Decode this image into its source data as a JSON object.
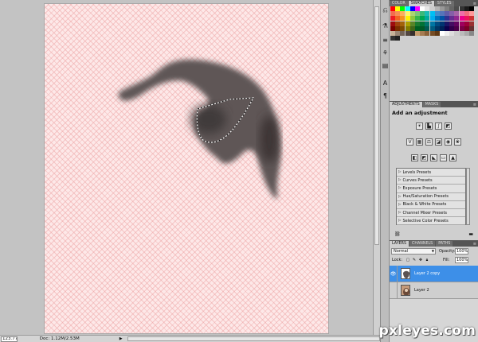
{
  "status": {
    "zoom": "123.77%",
    "doc_info": "Doc: 1.12M/2.53M",
    "arrow": "▶"
  },
  "swatches": {
    "tabs": [
      "COLOR",
      "SWATCHES",
      "STYLES"
    ],
    "active_tab": 1,
    "rows": [
      [
        "#ff0000",
        "#ffff00",
        "#00ff00",
        "#00ffff",
        "#0000ff",
        "#ff00ff",
        "#ffffff",
        "#e6e6e6",
        "#cccccc",
        "#b3b3b3",
        "#999999",
        "#808080",
        "#666666",
        "#4d4d4d",
        "#333333",
        "#1a1a1a",
        "#000000"
      ],
      [
        "#f26c4f",
        "#f68e55",
        "#fbaf5c",
        "#fff467",
        "#acd372",
        "#7cc576",
        "#3bb878",
        "#1abbb4",
        "#00bff3",
        "#438ccb",
        "#5574b9",
        "#605ca8",
        "#855fa8",
        "#a763a8",
        "#f06ea9",
        "#f26d7d",
        "#ff9999"
      ],
      [
        "#ed1c24",
        "#f26522",
        "#f7941d",
        "#fff200",
        "#8dc73f",
        "#39b54a",
        "#00a651",
        "#00a99d",
        "#00aeef",
        "#0072bc",
        "#0054a6",
        "#2e3192",
        "#662d91",
        "#92278f",
        "#ec008c",
        "#ed145b",
        "#cc3333"
      ],
      [
        "#9e0b0f",
        "#a0410d",
        "#a3620a",
        "#aba000",
        "#598527",
        "#1a7b30",
        "#007236",
        "#00746b",
        "#0076a3",
        "#004b80",
        "#003471",
        "#1b1464",
        "#440e62",
        "#630460",
        "#9e005d",
        "#9e0039",
        "#993333"
      ],
      [
        "#790000",
        "#7b2e00",
        "#7d4900",
        "#827b00",
        "#406618",
        "#005e20",
        "#005826",
        "#005952",
        "#005b7f",
        "#003663",
        "#002157",
        "#0d004c",
        "#32004b",
        "#4b0049",
        "#7b0046",
        "#7a0026",
        "#663333"
      ],
      [
        "#c7b299",
        "#998675",
        "#736357",
        "#534741",
        "#37302d",
        "#c69c6d",
        "#a67c52",
        "#8c6239",
        "#754c24",
        "#603913",
        "#ffffff",
        "#eeeeee",
        "#dddddd",
        "#cccccc",
        "#bbbbbb",
        "#aaaaaa",
        "#888888"
      ],
      [
        "#333333",
        "#222222"
      ]
    ]
  },
  "adjustments": {
    "tabs": [
      "ADJUSTMENTS",
      "MASKS"
    ],
    "active_tab": 0,
    "title": "Add an adjustment",
    "icons_row1": [
      "brightness-contrast-icon",
      "levels-icon",
      "curves-icon",
      "exposure-icon"
    ],
    "icons_row2": [
      "vibrance-icon",
      "hue-saturation-icon",
      "color-balance-icon",
      "black-white-icon",
      "photo-filter-icon",
      "channel-mixer-icon"
    ],
    "icons_row3": [
      "invert-icon",
      "posterize-icon",
      "threshold-icon",
      "gradient-map-icon",
      "selective-color-icon"
    ],
    "presets": [
      "Levels Presets",
      "Curves Presets",
      "Exposure Presets",
      "Hue/Saturation Presets",
      "Black & White Presets",
      "Channel Mixer Presets",
      "Selective Color Presets"
    ]
  },
  "layers": {
    "tabs": [
      "LAYERS",
      "CHANNELS",
      "PATHS"
    ],
    "active_tab": 0,
    "blend_mode": "Normal",
    "opacity_label": "Opacity:",
    "opacity": "100%",
    "lock_label": "Lock:",
    "fill_label": "Fill:",
    "fill": "100%",
    "items": [
      {
        "name": "Layer 2 copy",
        "visible": true,
        "selected": true
      },
      {
        "name": "Layer 2",
        "visible": false,
        "selected": false
      }
    ]
  },
  "watermark": "pxleyes.com",
  "colors": {
    "selection_blue": "#3d8fe8",
    "panel_bg": "#cfcfcf",
    "tab_dark": "#555555"
  }
}
